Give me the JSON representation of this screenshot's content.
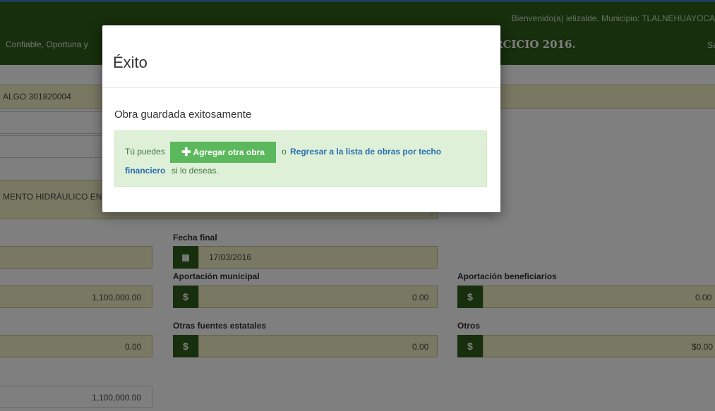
{
  "header": {
    "welcome": "Bienvenido(a) ielizalde. Municipio: TLALNEHUAYOCA",
    "slogan": "Confiable, Oportuna y",
    "ejercicio": "RCICIO 2016.",
    "right_fragment": "Sa"
  },
  "form": {
    "clave_text": "ALGO  301820004",
    "descripcion_text": "MENTO HIDRÁULICO EN",
    "fecha_final_label": "Fecha final",
    "fecha_final_value": "17/03/2016",
    "aportacion_municipal_label": "Aportación municipal",
    "aportacion_beneficiarios_label": "Aportación beneficiarios",
    "otras_fuentes_label": "Otras fuentes estatales",
    "otros_label": "Otros",
    "left_amount_1": "1,100,000.00",
    "aportacion_municipal_value": "0.00",
    "aportacion_beneficiarios_value": "0.00",
    "left_amount_2": "0.00",
    "otras_fuentes_value": "0.00",
    "otros_value": "$0.00",
    "total_amount": "1,100,000.00",
    "currency_symbol": "$"
  },
  "modal": {
    "title": "Éxito",
    "message": "Obra guardada exitosamente",
    "alert_prefix": "Tú puedes",
    "add_button_label": "Agregar otra obra",
    "alert_middle": "o",
    "return_link_part1": "Regresar a la lista de obras por techo",
    "return_link_part2": "financiero",
    "alert_suffix": "si lo deseas."
  },
  "colors": {
    "header_green": "#2e5e1a",
    "field_yellow": "#f3f1c7",
    "success_button": "#5cb85c",
    "alert_bg": "#dff0d8",
    "link_blue": "#2a6fb0"
  },
  "icons": {
    "calendar": "calendar-icon",
    "dollar": "dollar-icon",
    "plus": "plus-icon",
    "resize": "resize-handle-icon"
  }
}
